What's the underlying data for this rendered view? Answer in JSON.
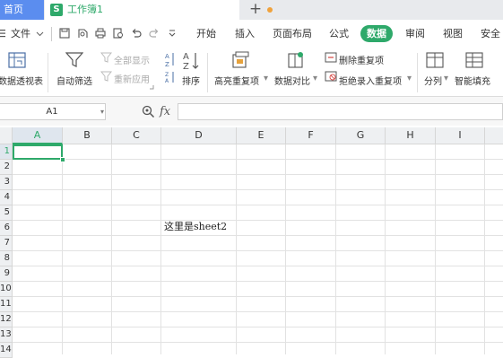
{
  "tabs": {
    "home": "首页",
    "document": "工作簿1",
    "doc_icon_letter": "S",
    "new_tab": "+"
  },
  "menu": {
    "file": "文件",
    "items": [
      "开始",
      "插入",
      "页面布局",
      "公式",
      "数据",
      "审阅",
      "视图",
      "安全"
    ],
    "active": "数据"
  },
  "ribbon": {
    "pivot": "数据透视表",
    "autofilter": "自动筛选",
    "show_all": "全部显示",
    "reapply": "重新应用",
    "sort": "排序",
    "highlight_dup": "高亮重复项",
    "compare": "数据对比",
    "remove_dup": "删除重复项",
    "reject_dup": "拒绝录入重复项",
    "split": "分列",
    "flash_fill": "智能填充"
  },
  "formula_bar": {
    "name_box": "A1",
    "fx": "fx",
    "value": ""
  },
  "sheet": {
    "columns": [
      "A",
      "B",
      "C",
      "D",
      "E",
      "F",
      "G",
      "H",
      "I"
    ],
    "rows": [
      "1",
      "2",
      "3",
      "4",
      "5",
      "6",
      "7",
      "8",
      "9",
      "10",
      "11",
      "12",
      "13",
      "14"
    ],
    "selected_column": "A",
    "selected_row": "1",
    "cell_d6": "这里是sheet2"
  },
  "colors": {
    "accent_green": "#2ea96a",
    "home_tab_blue": "#5b8def"
  }
}
